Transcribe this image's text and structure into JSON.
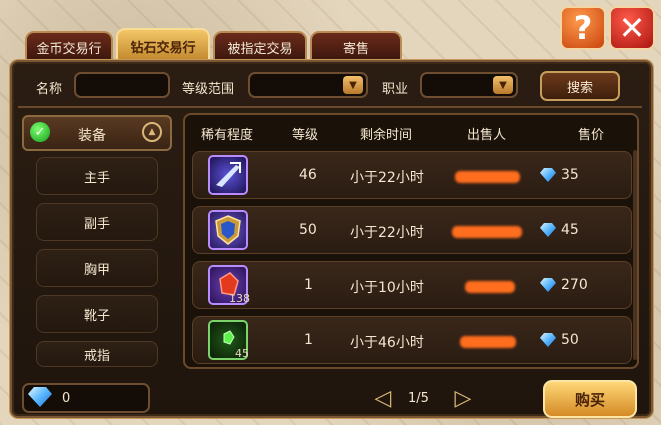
{
  "tabs": [
    {
      "label": "金币交易行"
    },
    {
      "label": "钻石交易行"
    },
    {
      "label": "被指定交易"
    },
    {
      "label": "寄售"
    }
  ],
  "filters": {
    "name_label": "名称",
    "name_value": "",
    "level_label": "等级范围",
    "level_value": "",
    "class_label": "职业",
    "class_value": "",
    "search_label": "搜索"
  },
  "category": {
    "title": "装备",
    "items": [
      "主手",
      "副手",
      "胸甲",
      "靴子",
      "戒指"
    ]
  },
  "table": {
    "headers": [
      "稀有程度",
      "等级",
      "剩余时间",
      "出售人",
      "售价"
    ],
    "rows": [
      {
        "item_icon": "sword-item-icon",
        "count": "",
        "level": "46",
        "time": "小于22小时",
        "seller": "",
        "price": "35"
      },
      {
        "item_icon": "shield-item-icon",
        "count": "",
        "level": "50",
        "time": "小于22小时",
        "seller": "",
        "price": "45"
      },
      {
        "item_icon": "red-gem-item-icon",
        "count": "138",
        "level": "1",
        "time": "小于10小时",
        "seller": "",
        "price": "270"
      },
      {
        "item_icon": "green-gem-item-icon",
        "count": "45",
        "level": "1",
        "time": "小于46小时",
        "seller": "",
        "price": "50"
      }
    ]
  },
  "footer": {
    "balance": "0",
    "page": "1/5",
    "buy_label": "购买"
  },
  "colors": {
    "accent_gold": "#f3c667",
    "price_diamond": "#5ab8ff",
    "seller_redaction": "#ff6d1e"
  }
}
